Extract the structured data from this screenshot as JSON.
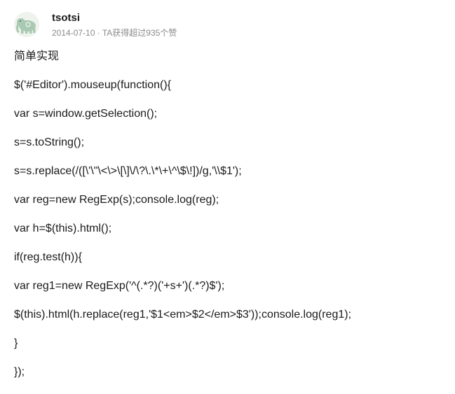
{
  "author": {
    "name": "tsotsi",
    "avatar_icon": "elephant-avatar-icon",
    "date": "2014-07-10",
    "separator": " · ",
    "stats": "TA获得超过935个赞"
  },
  "answer": {
    "lines": [
      "简单实现",
      "$('#Editor').mouseup(function(){",
      "var s=window.getSelection();",
      "s=s.toString();",
      "s=s.replace(/([\\'\\\"\\<\\>\\[\\]\\/\\?\\.\\*\\+\\^\\$\\!])/g,'\\\\$1');",
      "var reg=new RegExp(s);console.log(reg);",
      "var h=$(this).html();",
      "if(reg.test(h)){",
      "var reg1=new RegExp('^(.*?)('+s+')(.*?)$');",
      "$(this).html(h.replace(reg1,'$1<em>$2</em>$3'));console.log(reg1);",
      "}",
      "});"
    ]
  },
  "colors": {
    "text": "#1a1a1a",
    "meta": "#8a8a8a",
    "avatar_bg": "#eef3ee",
    "avatar_elephant": "#a9c9b2"
  }
}
